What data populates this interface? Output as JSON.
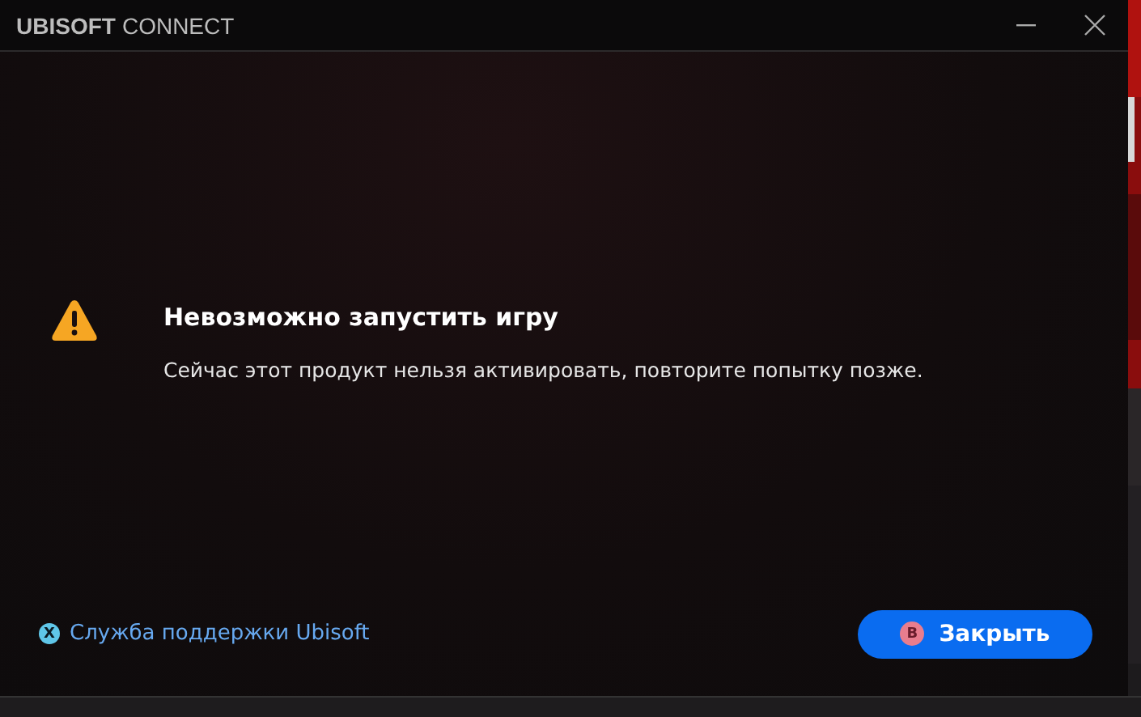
{
  "window": {
    "title_brand": "UBISOFT",
    "title_product": "CONNECT"
  },
  "message": {
    "title": "Невозможно запустить игру",
    "body": "Сейчас этот продукт нельзя активировать, повторите попытку позже."
  },
  "footer": {
    "support_link": "Служба поддержки Ubisoft",
    "close_button": "Закрыть",
    "close_button_key": "B",
    "support_key": "X"
  }
}
